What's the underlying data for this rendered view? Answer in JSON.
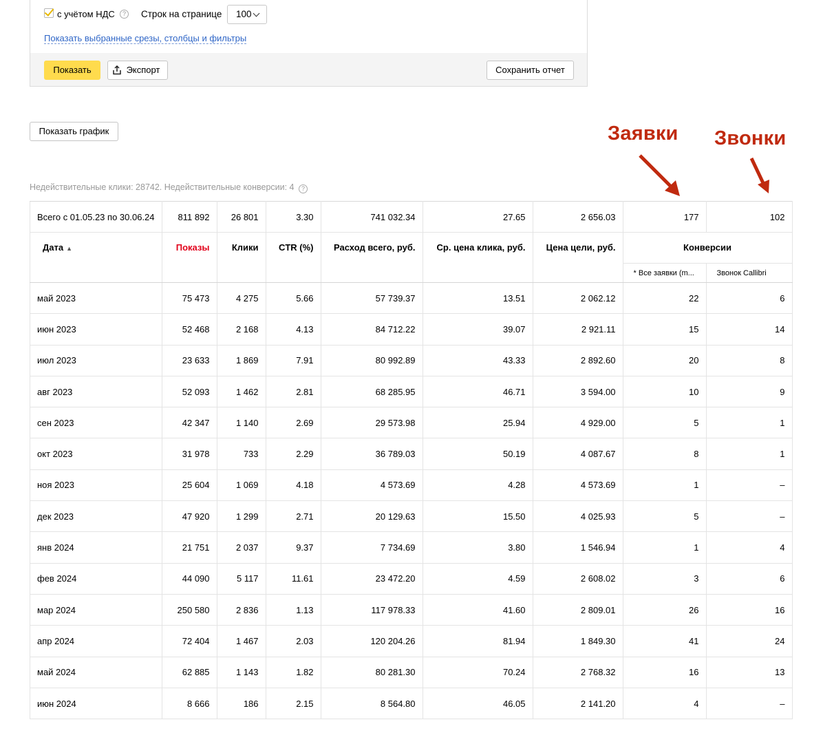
{
  "filters": {
    "vat_label": "с учётом НДС",
    "rows_label": "Строк на странице",
    "rows_value": "100",
    "show_selected_link": "Показать выбранные срезы, столбцы и фильтры"
  },
  "toolbar": {
    "show_label": "Показать",
    "export_label": "Экспорт",
    "save_label": "Сохранить отчет"
  },
  "graph_button": "Показать график",
  "annotations": {
    "leads": "Заявки",
    "calls": "Звонки"
  },
  "invalid_note": "Недействительные клики: 28742. Недействительные конверсии: 4",
  "totals": {
    "label": "Всего с 01.05.23 по 30.06.24",
    "values": [
      "811 892",
      "26 801",
      "3.30",
      "741 032.34",
      "27.65",
      "2 656.03",
      "177",
      "102"
    ]
  },
  "columns": {
    "date": "Дата",
    "sort_glyph": "▲",
    "impressions": "Показы",
    "clicks": "Клики",
    "ctr": "CTR (%)",
    "spend": "Расход всего, руб.",
    "cpc": "Ср. цена клика, руб.",
    "cpa": "Цена цели, руб.",
    "conversions": "Конверсии",
    "conv_all": "* Все заявки (m...",
    "conv_callibri": "Звонок Callibri"
  },
  "rows": [
    [
      "май 2023",
      "75 473",
      "4 275",
      "5.66",
      "57 739.37",
      "13.51",
      "2 062.12",
      "22",
      "6"
    ],
    [
      "июн 2023",
      "52 468",
      "2 168",
      "4.13",
      "84 712.22",
      "39.07",
      "2 921.11",
      "15",
      "14"
    ],
    [
      "июл 2023",
      "23 633",
      "1 869",
      "7.91",
      "80 992.89",
      "43.33",
      "2 892.60",
      "20",
      "8"
    ],
    [
      "авг 2023",
      "52 093",
      "1 462",
      "2.81",
      "68 285.95",
      "46.71",
      "3 594.00",
      "10",
      "9"
    ],
    [
      "сен 2023",
      "42 347",
      "1 140",
      "2.69",
      "29 573.98",
      "25.94",
      "4 929.00",
      "5",
      "1"
    ],
    [
      "окт 2023",
      "31 978",
      "733",
      "2.29",
      "36 789.03",
      "50.19",
      "4 087.67",
      "8",
      "1"
    ],
    [
      "ноя 2023",
      "25 604",
      "1 069",
      "4.18",
      "4 573.69",
      "4.28",
      "4 573.69",
      "1",
      "–"
    ],
    [
      "дек 2023",
      "47 920",
      "1 299",
      "2.71",
      "20 129.63",
      "15.50",
      "4 025.93",
      "5",
      "–"
    ],
    [
      "янв 2024",
      "21 751",
      "2 037",
      "9.37",
      "7 734.69",
      "3.80",
      "1 546.94",
      "1",
      "4"
    ],
    [
      "фев 2024",
      "44 090",
      "5 117",
      "11.61",
      "23 472.20",
      "4.59",
      "2 608.02",
      "3",
      "6"
    ],
    [
      "мар 2024",
      "250 580",
      "2 836",
      "1.13",
      "117 978.33",
      "41.60",
      "2 809.01",
      "26",
      "16"
    ],
    [
      "апр 2024",
      "72 404",
      "1 467",
      "2.03",
      "120 204.26",
      "81.94",
      "1 849.30",
      "41",
      "24"
    ],
    [
      "май 2024",
      "62 885",
      "1 143",
      "1.82",
      "80 281.30",
      "70.24",
      "2 768.32",
      "16",
      "13"
    ],
    [
      "июн 2024",
      "8 666",
      "186",
      "2.15",
      "8 564.80",
      "46.05",
      "2 141.20",
      "4",
      "–"
    ]
  ],
  "colors": {
    "accent_yellow": "#ffdb4d",
    "link_blue": "#2f66c7",
    "annotation_red": "#c02a0f",
    "impressions_red": "#e2001a"
  }
}
